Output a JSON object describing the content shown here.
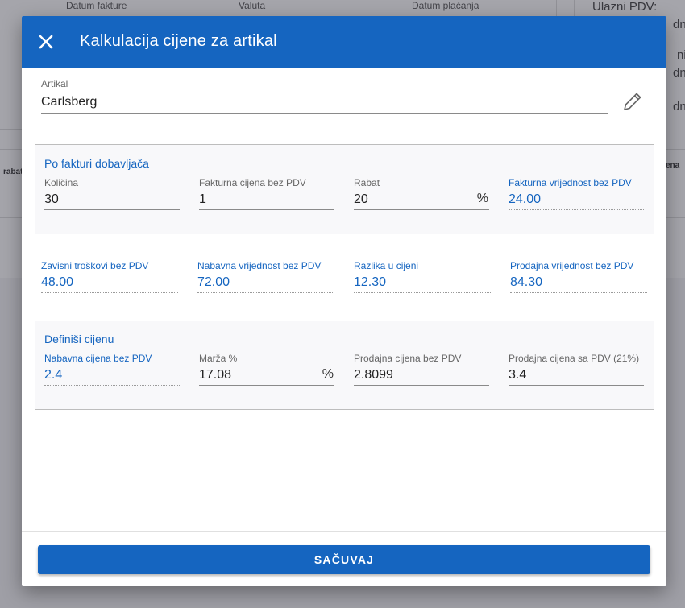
{
  "background": {
    "labels": [
      "Datum fakture",
      "Valuta",
      "Datum plaćanja"
    ],
    "right_top": "Ulazni PDV:",
    "right_fragments": [
      "dno",
      "ni:",
      "dno",
      "dno"
    ],
    "table_fragments": [
      "rabat",
      "ena"
    ]
  },
  "dialog": {
    "title": "Kalkulacija cijene za artikal",
    "artikal": {
      "label": "Artikal",
      "value": "Carlsberg"
    },
    "section1": {
      "title": "Po fakturi dobavljača",
      "kolicina": {
        "label": "Količina",
        "value": "30"
      },
      "fakturna_cijena": {
        "label": "Fakturna cijena bez PDV",
        "value": "1"
      },
      "rabat": {
        "label": "Rabat",
        "value": "20",
        "suffix": "%"
      },
      "fakturna_vrijednost": {
        "label": "Fakturna vrijednost bez PDV",
        "value": "24.00"
      }
    },
    "section2": {
      "zavisni_troskovi": {
        "label": "Zavisni troškovi bez PDV",
        "value": "48.00"
      },
      "nabavna_vrijednost": {
        "label": "Nabavna vrijednost bez PDV",
        "value": "72.00"
      },
      "razlika": {
        "label": "Razlika u cijeni",
        "value": "12.30"
      },
      "prodajna_vrijednost": {
        "label": "Prodajna vrijednost bez PDV",
        "value": "84.30"
      }
    },
    "section3": {
      "title": "Definiši cijenu",
      "nabavna_cijena": {
        "label": "Nabavna cijena bez PDV",
        "value": "2.4"
      },
      "marza": {
        "label": "Marža %",
        "value": "17.08",
        "suffix": "%"
      },
      "prodajna_bez_pdv": {
        "label": "Prodajna cijena bez PDV",
        "value": "2.8099"
      },
      "prodajna_sa_pdv": {
        "label": "Prodajna cijena sa PDV (21%)",
        "value": "3.4"
      }
    },
    "save_label": "SAČUVAJ"
  },
  "colors": {
    "primary": "#1565c0",
    "overlay": "#5a5a6e"
  }
}
